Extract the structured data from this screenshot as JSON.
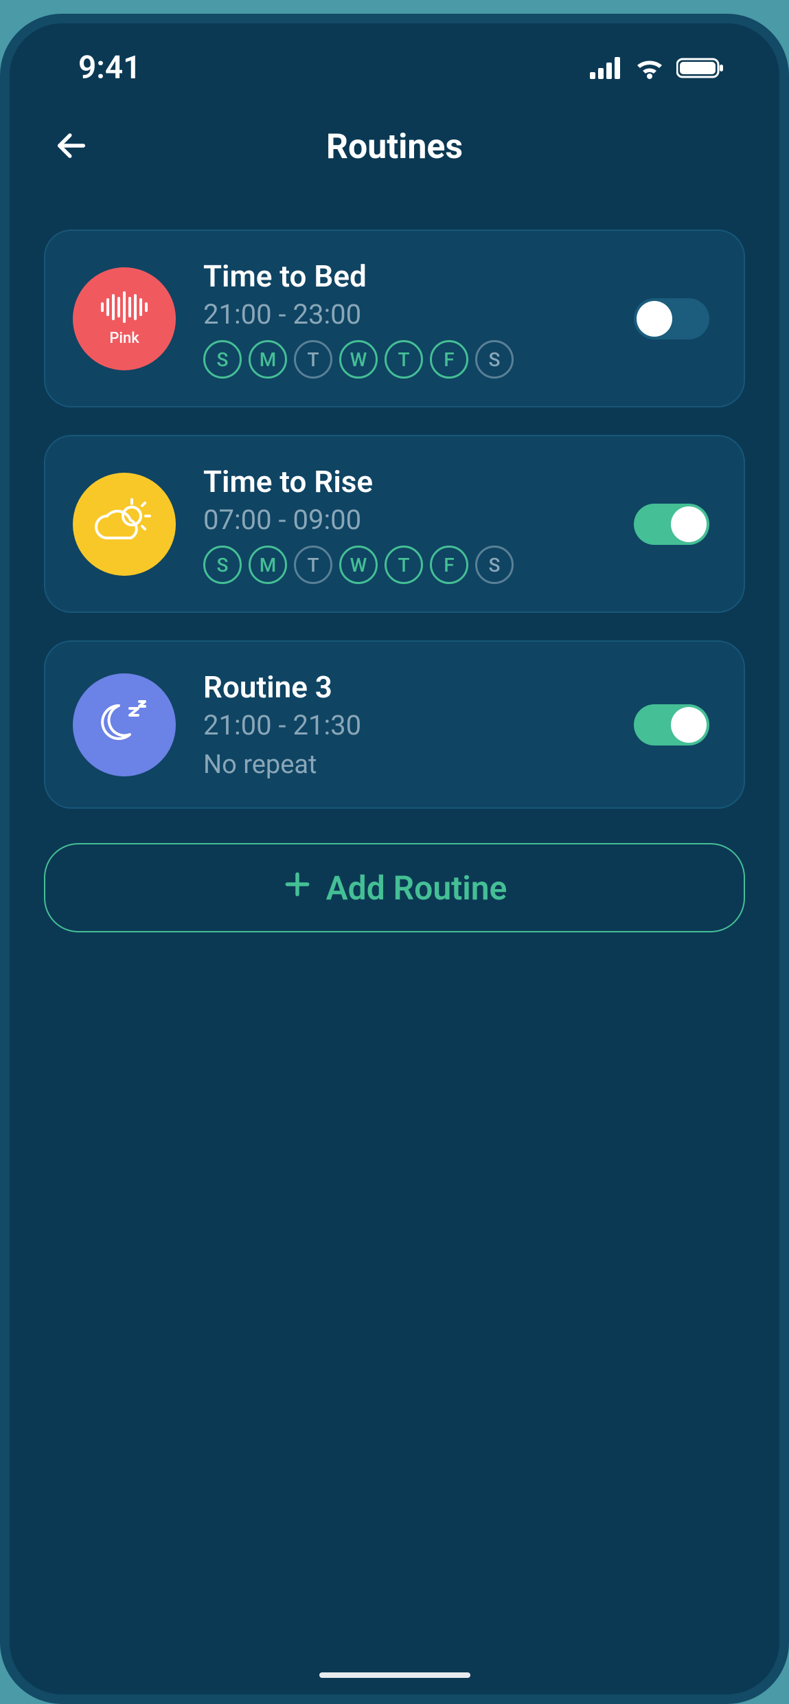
{
  "status": {
    "time": "9:41"
  },
  "header": {
    "title": "Routines"
  },
  "days_labels": [
    "S",
    "M",
    "T",
    "W",
    "T",
    "F",
    "S"
  ],
  "routines": [
    {
      "title": "Time to Bed",
      "time": "21:00 - 23:00",
      "avatar_color": "pink",
      "avatar_label": "Pink",
      "icon": "sound-wave",
      "enabled": false,
      "repeat_type": "days",
      "days_active": [
        true,
        true,
        false,
        true,
        true,
        true,
        false
      ]
    },
    {
      "title": "Time to Rise",
      "time": "07:00 - 09:00",
      "avatar_color": "yellow",
      "avatar_label": "",
      "icon": "sun-cloud",
      "enabled": true,
      "repeat_type": "days",
      "days_active": [
        true,
        true,
        false,
        true,
        true,
        true,
        false
      ]
    },
    {
      "title": "Routine 3",
      "time": "21:00 - 21:30",
      "avatar_color": "blue",
      "avatar_label": "",
      "icon": "moon-sleep",
      "enabled": true,
      "repeat_type": "none",
      "repeat_text": "No repeat"
    }
  ],
  "add_button": {
    "label": "Add Routine"
  },
  "icons": {
    "plus": "plus-icon",
    "back": "arrow-left-icon",
    "signal": "cellular-signal-icon",
    "wifi": "wifi-icon",
    "battery": "battery-icon"
  }
}
